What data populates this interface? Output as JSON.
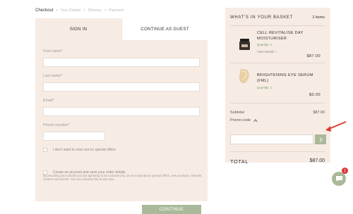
{
  "breadcrumb": {
    "current": "Checkout",
    "steps": [
      "Your Details",
      "Delivery",
      "Payment"
    ],
    "separator": ">"
  },
  "tabs": {
    "signin": "SIGN IN",
    "guest": "CONTINUE AS GUEST"
  },
  "form": {
    "first_name_label": "First name*",
    "last_name_label": "Last name*",
    "email_label": "Email*",
    "phone_label": "Phone number*",
    "offers_optout": "I don't want to miss out on special offers",
    "consent_text": "By providing your details you are agreeing to be contacted by us via email about special offers, new products, relevant content and events. You can unsubscribe at any time.",
    "create_account": "Create an account and save your order details",
    "continue_label": "CONTINUE"
  },
  "basket": {
    "title": "WHAT'S IN YOUR BASKET",
    "count": "2 Items",
    "items": [
      {
        "name": "CELL REVITALISE DAY MOISTURISER",
        "quantity": "Quantity: 1",
        "details_link": "View Details +",
        "price": "$87.00",
        "icon": "jar-icon"
      },
      {
        "name": "BRIGHTENING EYE SERUM (FML)",
        "quantity": "Quantity: 1",
        "price": "$0.00",
        "icon": "tube-icon"
      }
    ],
    "subtotal_label": "Subtotal",
    "subtotal_value": "$87.00",
    "promo_label": "Promo code",
    "total_label": "TOTAL",
    "total_value": "$87.00"
  },
  "chat": {
    "badge": "1"
  },
  "colors": {
    "panel": "#f7ece4",
    "accent": "#a9b99a",
    "annotation": "#e03a2a"
  }
}
